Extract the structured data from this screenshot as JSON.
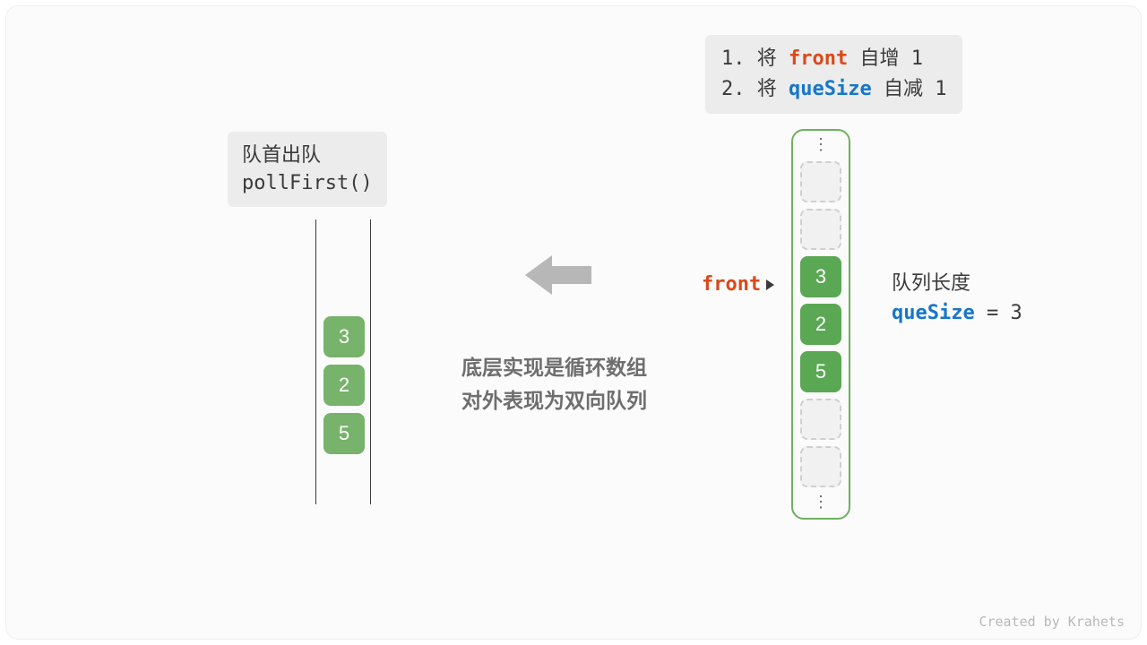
{
  "poll_label": {
    "title": "队首出队",
    "method": "pollFirst()"
  },
  "steps": {
    "line1_prefix": "1. 将 ",
    "line1_kw": "front",
    "line1_suffix": " 自增 1",
    "line2_prefix": "2. 将 ",
    "line2_kw": "queSize",
    "line2_suffix": " 自减 1"
  },
  "simple_queue": {
    "values": [
      "3",
      "2",
      "5"
    ]
  },
  "caption": {
    "line1": "底层实现是循环数组",
    "line2": "对外表现为双向队列"
  },
  "ring_array": {
    "slots": [
      {
        "state": "empty"
      },
      {
        "state": "empty"
      },
      {
        "state": "filled",
        "value": "3",
        "is_front": true
      },
      {
        "state": "filled",
        "value": "2"
      },
      {
        "state": "filled",
        "value": "5"
      },
      {
        "state": "empty"
      },
      {
        "state": "empty"
      }
    ]
  },
  "front_pointer": {
    "label": "front",
    "arrow": "▸"
  },
  "size_annotation": {
    "title": "队列长度",
    "var": "queSize",
    "eq": " = ",
    "value": "3"
  },
  "credit": "Created by Krahets",
  "colors": {
    "green": "#5aa853",
    "green_soft": "#77b36a",
    "orange": "#d94a1a",
    "blue": "#1676c9"
  }
}
